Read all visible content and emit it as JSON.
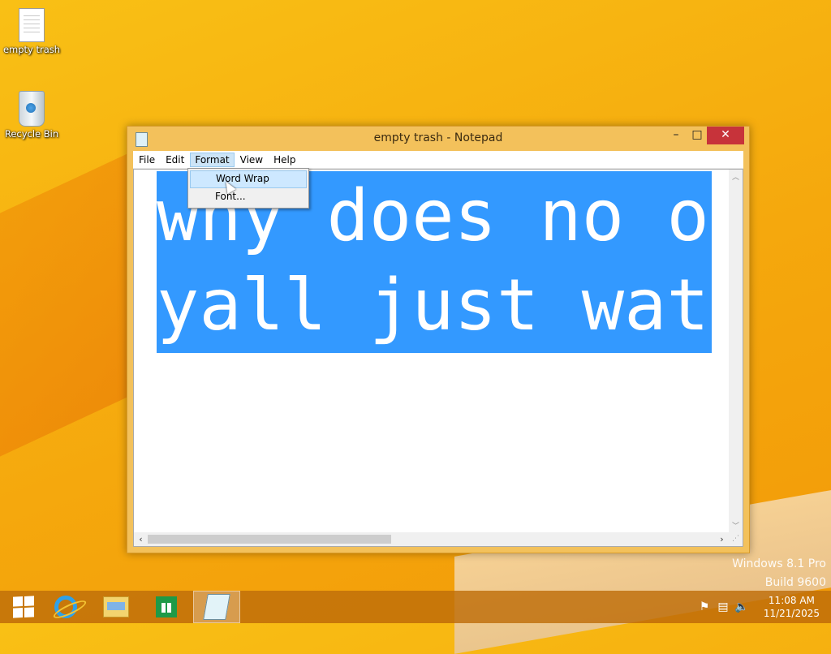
{
  "desktop": {
    "icons": [
      {
        "label": "empty trash",
        "icon": "text-file-icon"
      },
      {
        "label": "Recycle Bin",
        "icon": "recycle-bin-icon"
      }
    ],
    "watermark": {
      "line1": "Windows 8.1 Pro",
      "line2": "Build 9600"
    }
  },
  "window": {
    "title": "empty trash - Notepad",
    "controls": {
      "minimize": "–",
      "maximize": "□",
      "close": "✕"
    },
    "menu": [
      "File",
      "Edit",
      "Format",
      "View",
      "Help"
    ],
    "active_menu": "Format",
    "dropdown": [
      "Word Wrap",
      "Font..."
    ],
    "hovered_item": "Word Wrap",
    "content": {
      "line1": "why does no o",
      "line2": "yall just wat",
      "selected": true
    }
  },
  "taskbar": {
    "buttons": [
      "start-icon",
      "internet-explorer-icon",
      "file-explorer-icon",
      "store-icon",
      "notepad-icon"
    ],
    "active": "notepad-icon",
    "tray": [
      "flag-icon",
      "network-icon",
      "volume-muted-icon"
    ],
    "time": "11:08 AM",
    "date": "11/21/2025"
  },
  "colors": {
    "wallpaper": "#f5a80d",
    "selection": "#3399ff",
    "close_button": "#c7333a",
    "window_frame": "#f3c15b"
  }
}
